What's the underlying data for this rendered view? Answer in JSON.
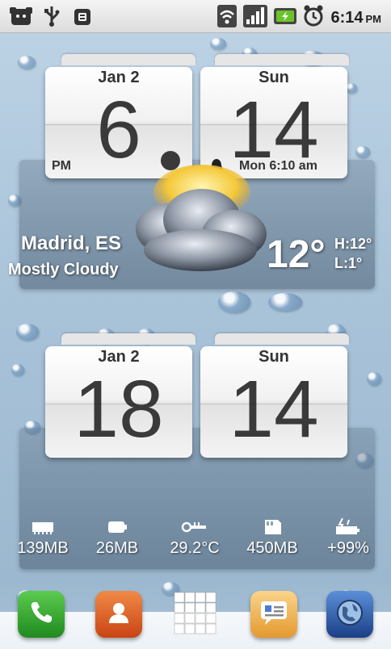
{
  "status_bar": {
    "time": "6:14",
    "ampm": "PM",
    "left_icons": [
      "usb-connected-icon",
      "usb-icon",
      "android-debug-icon"
    ],
    "right_icons": [
      "wifi-icon",
      "signal-icon",
      "battery-charging-icon",
      "alarm-clock-icon"
    ]
  },
  "clock_widget": {
    "date_label": "Jan 2",
    "day_label": "Sun",
    "hour": "6",
    "minute": "14",
    "ampm": "PM",
    "alarm": "Mon 6:10 am"
  },
  "weather": {
    "city": "Madrid, ES",
    "condition": "Mostly Cloudy",
    "temp": "12°",
    "high": "H:12°",
    "low": "L:1°",
    "icon": "partly-cloudy-icon"
  },
  "second_widget": {
    "date_label": "Jan 2",
    "day_label": "Sun",
    "left_number": "18",
    "right_number": "14"
  },
  "stats": [
    {
      "icon": "ram-icon",
      "value": "139MB"
    },
    {
      "icon": "storage-icon",
      "value": "26MB"
    },
    {
      "icon": "thermometer-icon",
      "value": "29.2°C"
    },
    {
      "icon": "sd-card-icon",
      "value": "450MB"
    },
    {
      "icon": "battery-level-icon",
      "value": "+99%"
    }
  ],
  "dock": [
    {
      "name": "phone-icon",
      "color": "#2f9e2f"
    },
    {
      "name": "contacts-icon",
      "color": "#e2622a"
    },
    {
      "name": "app-drawer-icon",
      "color": "#ffffff"
    },
    {
      "name": "messaging-icon",
      "color": "#f2b45a"
    },
    {
      "name": "browser-icon",
      "color": "#2a62b8"
    }
  ]
}
